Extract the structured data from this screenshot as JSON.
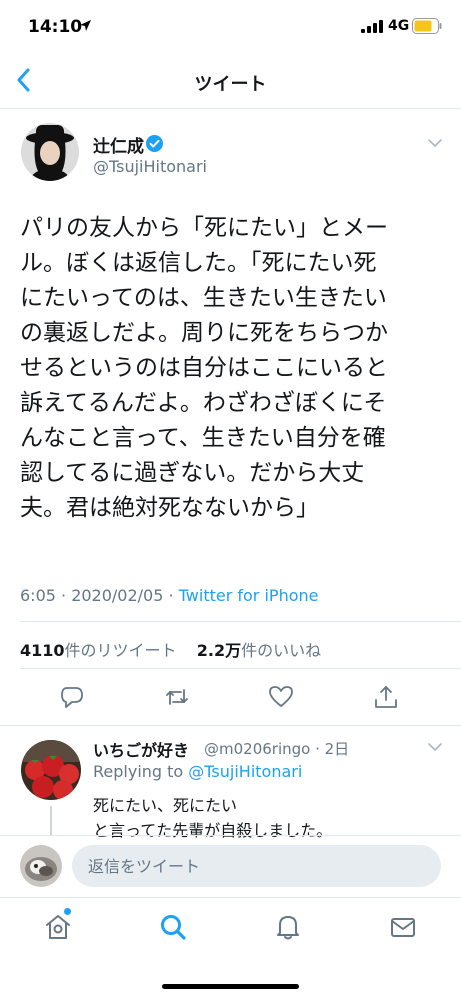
{
  "status_bar": {
    "time": "14:10",
    "network": "4G"
  },
  "header": {
    "title": "ツイート"
  },
  "tweet": {
    "author_name": "辻仁成",
    "author_handle": "@TsujiHitonari",
    "text_lines": [
      "パリの友人から「死にたい」とメー",
      "ル。ぼくは返信した。「死にたい死",
      "にたいってのは、生きたい生きたい",
      "の裏返しだよ。周りに死をちらつか",
      "せるというのは自分はここにいると",
      "訴えてるんだよ。わざわざぼくにそ",
      "んなこと言って、生きたい自分を確",
      "認してるに過ぎない。だから大丈",
      "夫。君は絶対死なないから」"
    ],
    "timestamp": "6:05 · 2020/02/05 · ",
    "source": "Twitter for iPhone",
    "retweet_count": "4110",
    "retweet_label": "件のリツイート",
    "like_count": "2.2万",
    "like_label": "件のいいね"
  },
  "reply": {
    "author_name": "いちごが好き",
    "author_handle": "@m0206ringo · 2日",
    "replying_prefix": "Replying to ",
    "replying_to": "@TsujiHitonari",
    "text_line1": "死にたい、死にたい",
    "text_line2": "と言ってた先輩が自殺しました。"
  },
  "compose": {
    "placeholder": "返信をツイート"
  },
  "tabs": [
    "home",
    "search",
    "notifications",
    "messages"
  ],
  "colors": {
    "accent": "#1da1f2",
    "text": "#14171a",
    "secondary": "#657786",
    "divider": "#e1e8ed",
    "battery": "#f5c518"
  }
}
